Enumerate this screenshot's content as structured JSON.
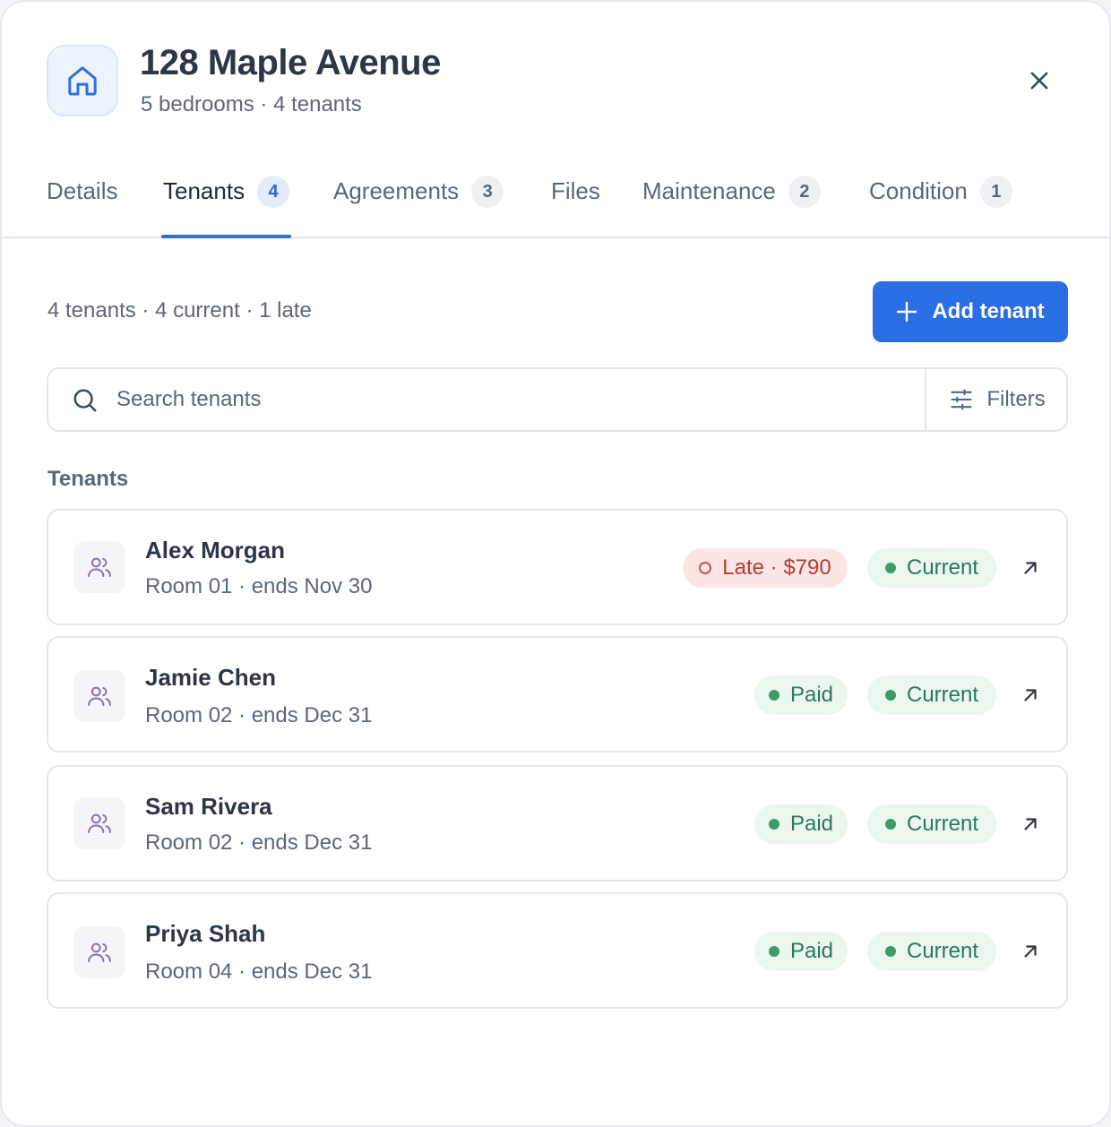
{
  "header": {
    "title": "128 Maple Avenue",
    "subtitle": "5 bedrooms · 4 tenants",
    "icon": "home-icon"
  },
  "tabs": [
    {
      "label": "Details",
      "count": null,
      "active": false
    },
    {
      "label": "Tenants",
      "count": "4",
      "active": true
    },
    {
      "label": "Agreements",
      "count": "3",
      "active": false
    },
    {
      "label": "Files",
      "count": null,
      "active": false
    },
    {
      "label": "Maintenance",
      "count": "2",
      "active": false
    },
    {
      "label": "Condition",
      "count": "1",
      "active": false
    }
  ],
  "summary": "4 tenants · 4 current · 1 late",
  "add_button": {
    "label": "Add tenant",
    "icon": "plus-icon"
  },
  "search": {
    "placeholder": "Search tenants",
    "value": "",
    "filters_label": "Filters"
  },
  "section_title": "Tenants",
  "tenants": [
    {
      "name": "Alex Morgan",
      "meta": "Room 01 · ends Nov 30",
      "payment": "Late · $790",
      "payment_status": "late",
      "occupancy": "Current"
    },
    {
      "name": "Jamie Chen",
      "meta": "Room 02 · ends Dec 31",
      "payment": "Paid",
      "payment_status": "paid",
      "occupancy": "Current"
    },
    {
      "name": "Sam Rivera",
      "meta": "Room 02 · ends Dec 31",
      "payment": "Paid",
      "payment_status": "paid",
      "occupancy": "Current"
    },
    {
      "name": "Priya Shah",
      "meta": "Room 04 · ends Dec 31",
      "payment": "Paid",
      "payment_status": "paid",
      "occupancy": "Current"
    }
  ],
  "colors": {
    "accent": "#2a6ee4",
    "paid_bg": "#ebf6ef",
    "paid_text": "#2c7a55",
    "late_bg": "#fbe6e5",
    "late_text": "#b43c35"
  }
}
